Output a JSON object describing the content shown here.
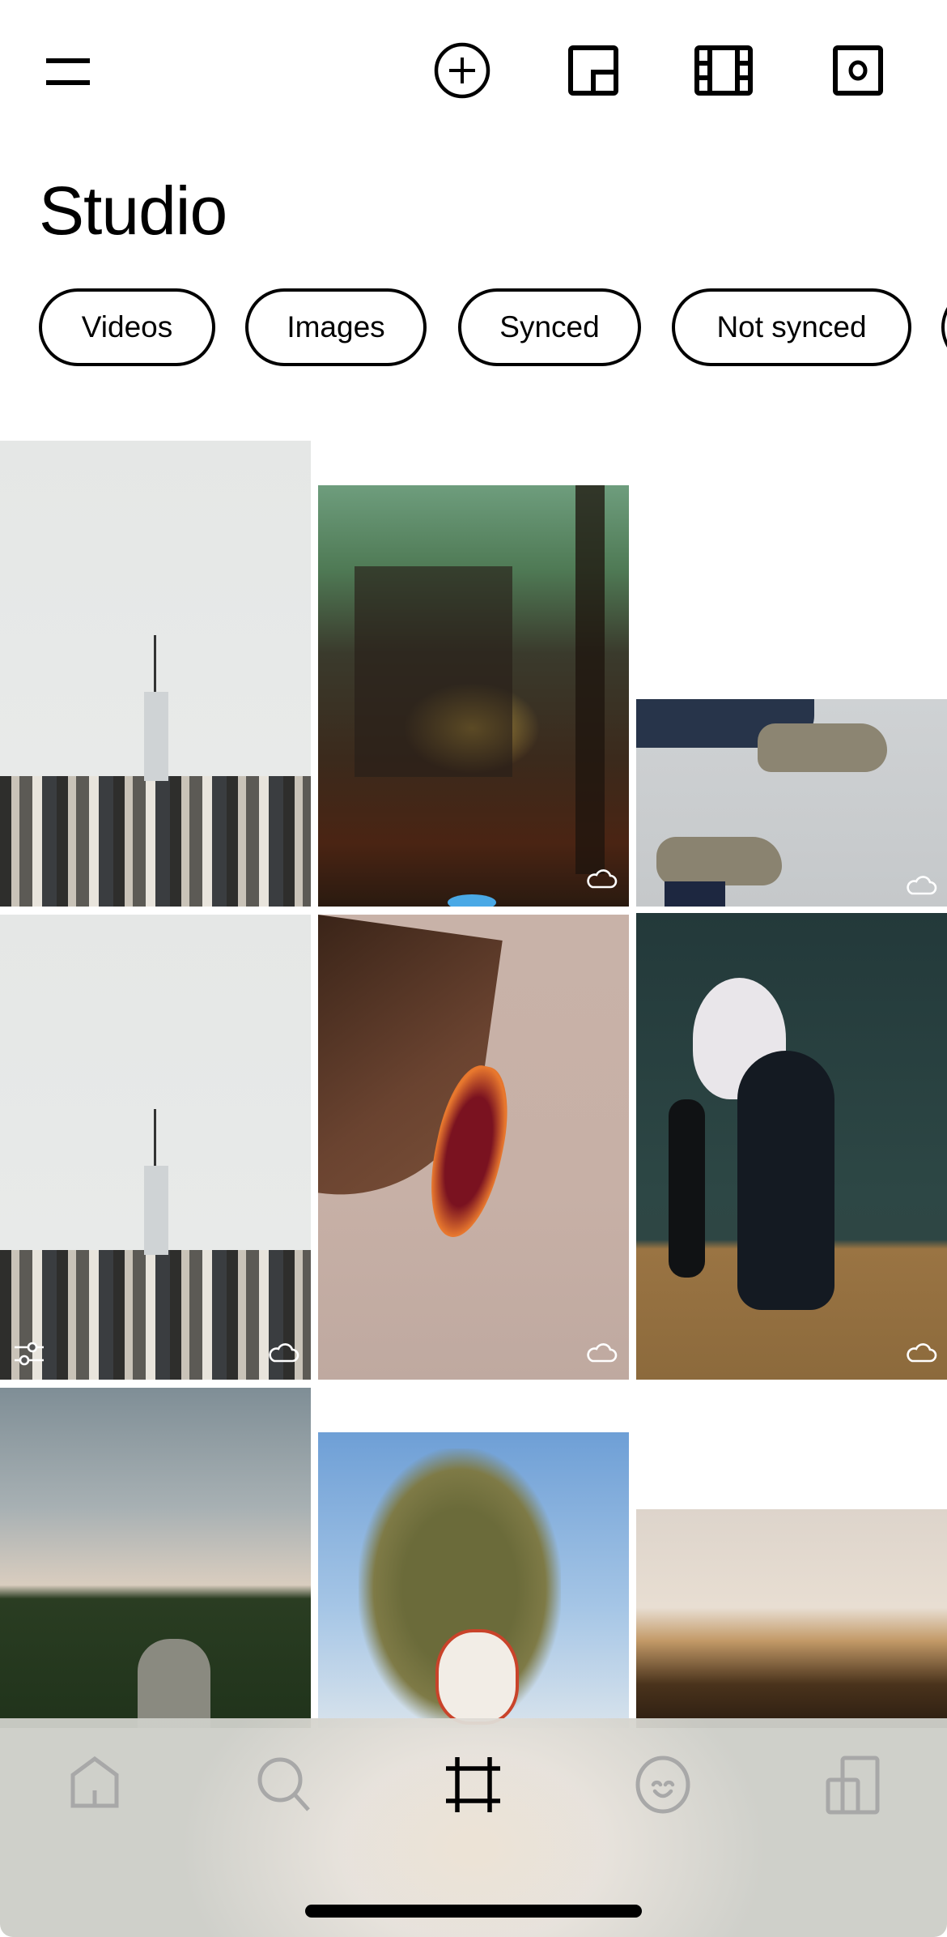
{
  "header": {
    "menu_icon": "hamburger-menu-icon",
    "actions": [
      {
        "name": "create-button",
        "icon": "plus-circle-icon"
      },
      {
        "name": "layout-button",
        "icon": "picture-in-picture-icon"
      },
      {
        "name": "video-button",
        "icon": "film-strip-icon"
      },
      {
        "name": "camera-button",
        "icon": "camera-icon"
      }
    ],
    "title": "Studio"
  },
  "filters": [
    {
      "label": "Videos"
    },
    {
      "label": "Images"
    },
    {
      "label": "Synced"
    },
    {
      "label": "Not synced"
    }
  ],
  "gallery": {
    "items": [
      {
        "subject": "city skyline",
        "badges": []
      },
      {
        "subject": "house at night",
        "badges": [
          "cloud-icon"
        ]
      },
      {
        "subject": "shoes on cobblestones",
        "badges": [
          "cloud-icon"
        ]
      },
      {
        "subject": "city skyline edited",
        "badges": [
          "adjust-icon",
          "cloud-icon"
        ]
      },
      {
        "subject": "hand squeezing blood orange",
        "badges": [
          "cloud-icon"
        ]
      },
      {
        "subject": "woman in headscarf pose",
        "badges": [
          "cloud-icon"
        ]
      },
      {
        "subject": "forested hill",
        "badges": []
      },
      {
        "subject": "tree and basketball hoop",
        "badges": []
      },
      {
        "subject": "sunset landscape",
        "badges": []
      }
    ]
  },
  "tabbar": {
    "tabs": [
      {
        "name": "home",
        "icon": "home-icon",
        "active": false
      },
      {
        "name": "search",
        "icon": "search-icon",
        "active": false
      },
      {
        "name": "studio",
        "icon": "frame-icon",
        "active": true
      },
      {
        "name": "profile",
        "icon": "smiley-icon",
        "active": false
      },
      {
        "name": "insights",
        "icon": "bar-chart-icon",
        "active": false
      }
    ],
    "active_color": "#000000",
    "inactive_color": "#a8a8a8"
  }
}
